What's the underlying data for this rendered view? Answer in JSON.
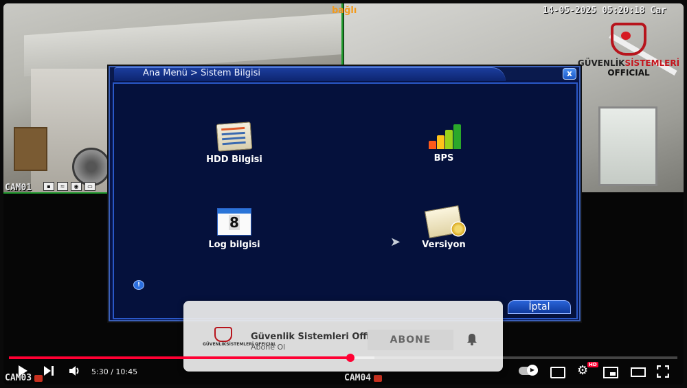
{
  "overlay": {
    "connection_status": "bağlı",
    "datetime": "14-05-2025 05:20:18 Car"
  },
  "brand": {
    "name_part1": "GÜVENLİK",
    "name_part2": "SİSTEMLERİ",
    "sub": "OFFICIAL"
  },
  "cameras": [
    {
      "label": "CAM01"
    },
    {
      "label": "CAM03"
    },
    {
      "label": "CAM04"
    }
  ],
  "dialog": {
    "title": "Ana Menü > Sistem Bilgisi",
    "close_label": "x",
    "items": [
      {
        "label": "HDD Bilgisi",
        "icon": "hdd-document-icon"
      },
      {
        "label": "BPS",
        "icon": "bar-chart-icon"
      },
      {
        "label": "Log bilgisi",
        "icon": "calendar-icon"
      },
      {
        "label": "Versiyon",
        "icon": "certificate-icon"
      }
    ],
    "calendar_day": "8",
    "info_icon": "!",
    "cancel_label": "İptal"
  },
  "subscribe": {
    "logo_text": "GÜVENLİKSİSTEMLERİ OFFICIAL",
    "channel": "Güvenlik Sistemleri Official",
    "cta": "Abone Ol",
    "button": "ABONE"
  },
  "player": {
    "time": "5:30 / 10:45",
    "played_fraction": 0.511,
    "buffered_fraction": 0.547,
    "hd_badge": "HD",
    "accent": "#ff0033"
  }
}
